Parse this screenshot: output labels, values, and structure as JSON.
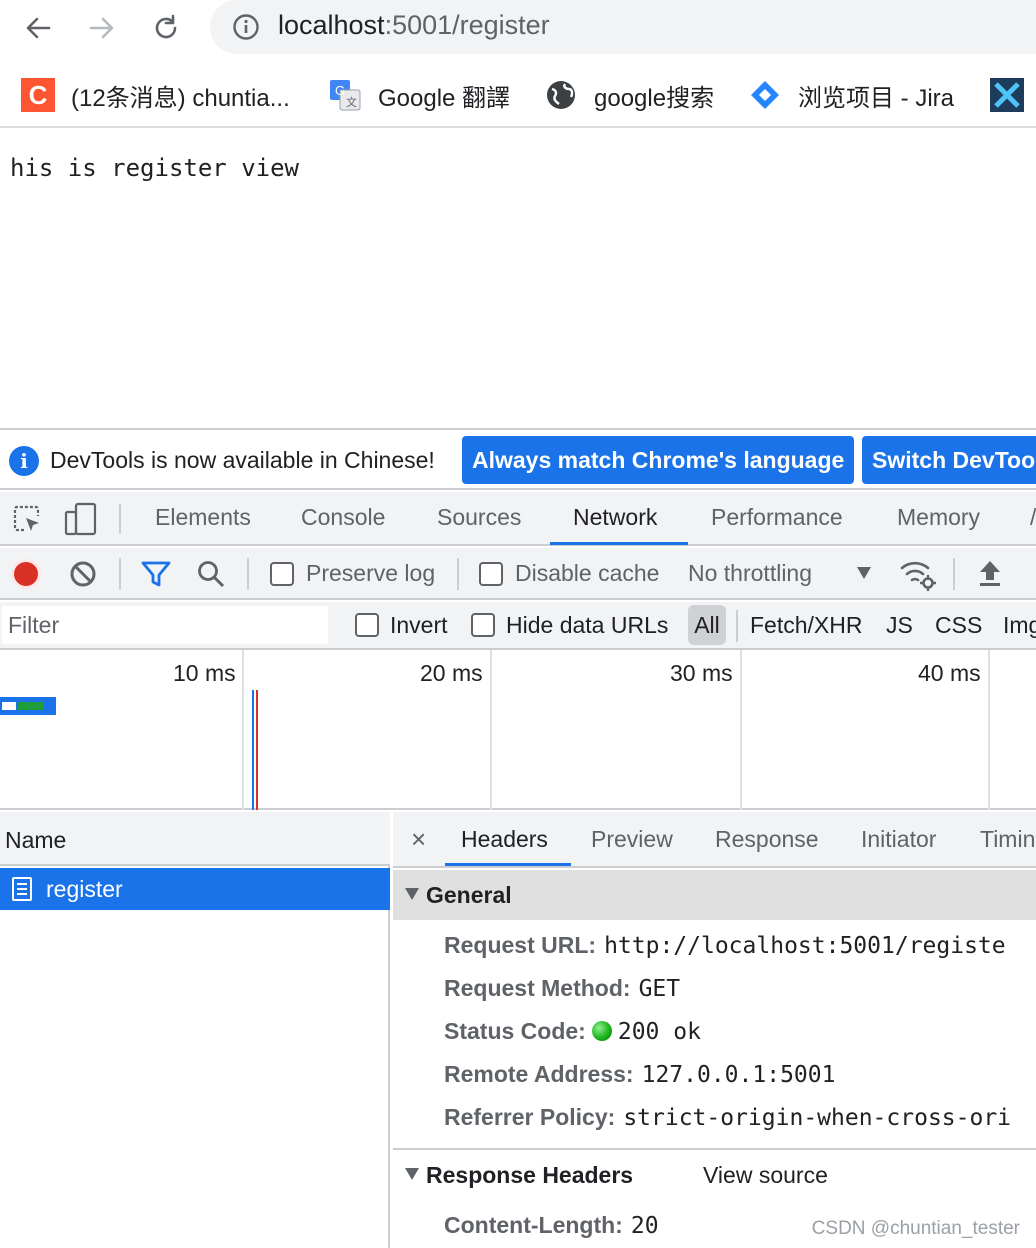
{
  "browser": {
    "url_host": "localhost",
    "url_path": ":5001/register",
    "bookmarks": [
      {
        "label": "(12条消息) chuntia...",
        "icon": "csdn-icon"
      },
      {
        "label": "Google 翻譯",
        "icon": "google-translate-icon"
      },
      {
        "label": "google搜索",
        "icon": "globe-icon"
      },
      {
        "label": "浏览项目 - Jira",
        "icon": "jira-icon"
      }
    ]
  },
  "page": {
    "text": "his is register view"
  },
  "devtools": {
    "infobar": {
      "message": "DevTools is now available in Chinese!",
      "button_match": "Always match Chrome's language",
      "button_switch": "Switch DevToo"
    },
    "tabs": [
      "Elements",
      "Console",
      "Sources",
      "Network",
      "Performance",
      "Memory"
    ],
    "active_tab": "Network",
    "toolbar": {
      "preserve_log": "Preserve log",
      "disable_cache": "Disable cache",
      "throttling": "No throttling"
    },
    "filterbar": {
      "placeholder": "Filter",
      "invert": "Invert",
      "hide_data_urls": "Hide data URLs",
      "all": "All",
      "types": [
        "Fetch/XHR",
        "JS",
        "CSS",
        "Img"
      ]
    },
    "timeline": {
      "ticks": [
        "10 ms",
        "20 ms",
        "30 ms",
        "40 ms"
      ]
    },
    "requests": {
      "name_header": "Name",
      "items": [
        "register"
      ]
    },
    "details": {
      "close": "×",
      "tabs": [
        "Headers",
        "Preview",
        "Response",
        "Initiator",
        "Timin"
      ],
      "active_tab": "Headers",
      "general_title": "General",
      "general": [
        {
          "key": "Request URL:",
          "value": "http://localhost:5001/registe"
        },
        {
          "key": "Request Method:",
          "value": "GET"
        },
        {
          "key": "Status Code:",
          "value": "200 ok"
        },
        {
          "key": "Remote Address:",
          "value": "127.0.0.1:5001"
        },
        {
          "key": "Referrer Policy:",
          "value": "strict-origin-when-cross-ori"
        }
      ],
      "response_headers_title": "Response Headers",
      "view_source": "View source",
      "response_headers": [
        {
          "key": "Content-Length:",
          "value": "20"
        }
      ]
    }
  },
  "watermark": "CSDN @chuntian_tester",
  "colors": {
    "accent": "#1a73e8",
    "record": "#d93025",
    "status_ok": "#1bb41b"
  }
}
